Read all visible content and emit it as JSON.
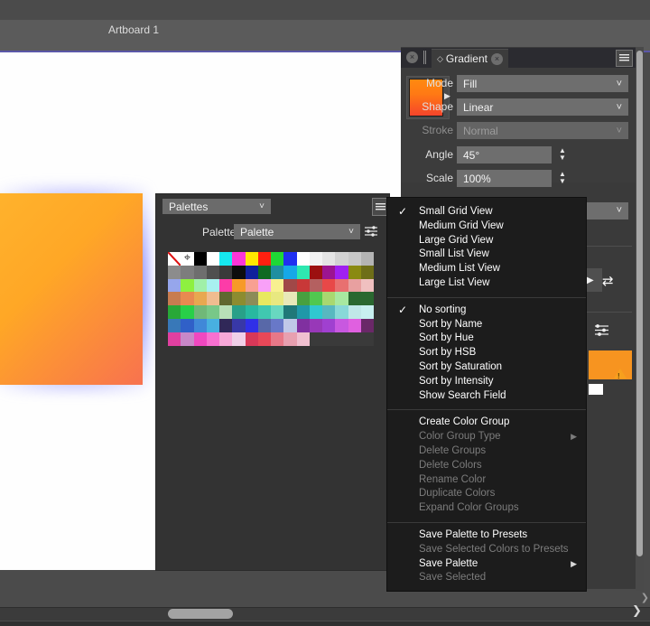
{
  "app": {
    "artboard_label": "Artboard 1",
    "accent_orange": "#f79420",
    "accent_purple": "#5b57a8",
    "panel_bg": "#3a3a3a",
    "menu_bg": "#1c1c1c"
  },
  "gradient_panel": {
    "tab_label": "Gradient",
    "close_icon": "close-circle-icon",
    "float_icon": "updown-chevrons-icon",
    "menu_icon": "hamburger-icon",
    "swatch_arrow_icon": "triangle-right-icon",
    "rows": [
      {
        "label": "Mode",
        "value": "Fill",
        "type": "combo",
        "disabled": false
      },
      {
        "label": "Shape",
        "value": "Linear",
        "type": "combo",
        "disabled": false
      },
      {
        "label": "Stroke",
        "value": "Normal",
        "type": "combo",
        "disabled": true
      },
      {
        "label": "Angle",
        "value": "45°",
        "type": "stepper",
        "disabled": false
      },
      {
        "label": "Scale",
        "value": "100%",
        "type": "stepper",
        "disabled": false
      }
    ]
  },
  "dock_extras": {
    "swap_icon": "swap-arrows-icon",
    "sliders_icon": "sliders-icon",
    "warning_icon": "warning-triangle-icon",
    "chip_color": "#f79420"
  },
  "palettes_panel": {
    "panel_selector": "Palettes",
    "menu_icon": "hamburger-icon",
    "palette_label": "Palette",
    "palette_value": "Palette",
    "settings_icon": "sliders-icon",
    "swatch_colors": [
      "#ffffff",
      "#ffffff",
      "#000000",
      "#ffffff",
      "#16e8f0",
      "#fc36d8",
      "#ffe800",
      "#ff2010",
      "#1fd835",
      "#2030f0",
      "#ffffff",
      "#f2f2f2",
      "#e4e4e4",
      "#d2d2d2",
      "#c8c8c8",
      "#b4b4b4",
      "#8c8c8c",
      "#7d7d7d",
      "#6e6e6e",
      "#4f4f4f",
      "#3a3a3a",
      "#0d0d0d",
      "#10209c",
      "#0f6a22",
      "#1f8fa0",
      "#16a8e8",
      "#2ee8b0",
      "#9c1010",
      "#9c1490",
      "#a020f0",
      "#8a8a12",
      "#6e6e18",
      "#96a6ec",
      "#8ef040",
      "#a0f0a8",
      "#a8f0f0",
      "#fc3ca8",
      "#f79a28",
      "#f8a092",
      "#f8a0f8",
      "#f8f090",
      "#a04848",
      "#c83838",
      "#b46060",
      "#e84848",
      "#e87070",
      "#e8a0a0",
      "#f0c0c0",
      "#c87c50",
      "#e88a50",
      "#e8a850",
      "#f0bc90",
      "#606830",
      "#8c8c30",
      "#8c8c58",
      "#e8e860",
      "#e8e880",
      "#e8e8b8",
      "#48a040",
      "#50c850",
      "#a8d870",
      "#a8e8a0",
      "#2a6830",
      "#2a6830",
      "#28a838",
      "#28d048",
      "#70b878",
      "#78c888",
      "#b8e0b8",
      "#28a088",
      "#28b8a0",
      "#40c8b0",
      "#68d8c0",
      "#207878",
      "#2098a8",
      "#30c8d0",
      "#58b8c0",
      "#88d8d8",
      "#c0e8e8",
      "#c8f0f0",
      "#3878b8",
      "#3060c8",
      "#4088d8",
      "#48b0e0",
      "#302858",
      "#3838a8",
      "#3030e8",
      "#5868a8",
      "#6878c8",
      "#c0c8e8",
      "#8030a0",
      "#9838b8",
      "#a040d0",
      "#c858e0",
      "#e060e0",
      "#6a2868",
      "#e040a0",
      "#c888c8",
      "#f048c0",
      "#f870d0",
      "#f8a8d8",
      "#f0d0e8",
      "#d83858",
      "#e84858",
      "#e87888",
      "#e8a0b0",
      "#f0c0d0",
      "#3a3a3a",
      "#3a3a3a",
      "#3a3a3a",
      "#3a3a3a",
      "#3a3a3a"
    ]
  },
  "context_menu": {
    "groups": [
      {
        "items": [
          {
            "label": "Small Grid View",
            "checked": true,
            "disabled": false,
            "submenu": false
          },
          {
            "label": "Medium Grid View",
            "checked": false,
            "disabled": false,
            "submenu": false
          },
          {
            "label": "Large Grid View",
            "checked": false,
            "disabled": false,
            "submenu": false
          },
          {
            "label": "Small List View",
            "checked": false,
            "disabled": false,
            "submenu": false
          },
          {
            "label": "Medium List View",
            "checked": false,
            "disabled": false,
            "submenu": false
          },
          {
            "label": "Large List View",
            "checked": false,
            "disabled": false,
            "submenu": false
          }
        ]
      },
      {
        "items": [
          {
            "label": "No sorting",
            "checked": true,
            "disabled": false,
            "submenu": false
          },
          {
            "label": "Sort by Name",
            "checked": false,
            "disabled": false,
            "submenu": false
          },
          {
            "label": "Sort by Hue",
            "checked": false,
            "disabled": false,
            "submenu": false
          },
          {
            "label": "Sort by HSB",
            "checked": false,
            "disabled": false,
            "submenu": false
          },
          {
            "label": "Sort by Saturation",
            "checked": false,
            "disabled": false,
            "submenu": false
          },
          {
            "label": "Sort by Intensity",
            "checked": false,
            "disabled": false,
            "submenu": false
          },
          {
            "label": "Show Search Field",
            "checked": false,
            "disabled": false,
            "submenu": false
          }
        ]
      },
      {
        "items": [
          {
            "label": "Create Color Group",
            "checked": false,
            "disabled": false,
            "submenu": false
          },
          {
            "label": "Color Group Type",
            "checked": false,
            "disabled": true,
            "submenu": true
          },
          {
            "label": "Delete Groups",
            "checked": false,
            "disabled": true,
            "submenu": false
          },
          {
            "label": "Delete Colors",
            "checked": false,
            "disabled": true,
            "submenu": false
          },
          {
            "label": "Rename Color",
            "checked": false,
            "disabled": true,
            "submenu": false
          },
          {
            "label": "Duplicate Colors",
            "checked": false,
            "disabled": true,
            "submenu": false
          },
          {
            "label": "Expand Color Groups",
            "checked": false,
            "disabled": true,
            "submenu": false
          }
        ]
      },
      {
        "items": [
          {
            "label": "Save Palette to Presets",
            "checked": false,
            "disabled": false,
            "submenu": false
          },
          {
            "label": "Save Selected Colors to Presets",
            "checked": false,
            "disabled": true,
            "submenu": false
          },
          {
            "label": "Save Palette",
            "checked": false,
            "disabled": false,
            "submenu": true
          },
          {
            "label": "Save Selected",
            "checked": false,
            "disabled": true,
            "submenu": false
          }
        ]
      }
    ]
  },
  "scrollbars": {
    "horizontal_icon": "h-scrollbar",
    "vertical_icon": "v-scrollbar",
    "expand_icon": "chevron-right-icon"
  }
}
